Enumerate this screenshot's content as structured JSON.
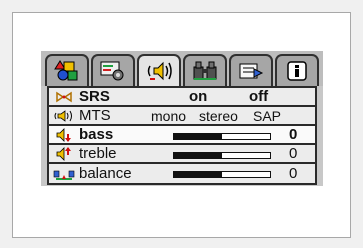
{
  "tabs": [
    {
      "icon": "shapes-icon",
      "active": false
    },
    {
      "icon": "settings-tools-icon",
      "active": false
    },
    {
      "icon": "audio-speaker-icon",
      "active": true
    },
    {
      "icon": "binoculars-icon",
      "active": false
    },
    {
      "icon": "input-source-icon",
      "active": false
    },
    {
      "icon": "info-icon",
      "active": false
    }
  ],
  "rows": {
    "srs": {
      "label": "SRS",
      "opt1": "on",
      "opt2": "off"
    },
    "mts": {
      "label": "MTS",
      "opt1": "mono",
      "opt2": "stereo",
      "opt3": "SAP"
    },
    "bass": {
      "label": "bass",
      "value": "0",
      "level": 0.5
    },
    "treble": {
      "label": "treble",
      "value": "0",
      "level": 0.5
    },
    "balance": {
      "label": "balance",
      "value": "0",
      "level": 0.5
    }
  },
  "colors": {
    "panel": "#c8c8c8",
    "row": "#ececec",
    "border": "#2a2a2a",
    "accent_red": "#d01010",
    "accent_yellow": "#f0c000"
  }
}
